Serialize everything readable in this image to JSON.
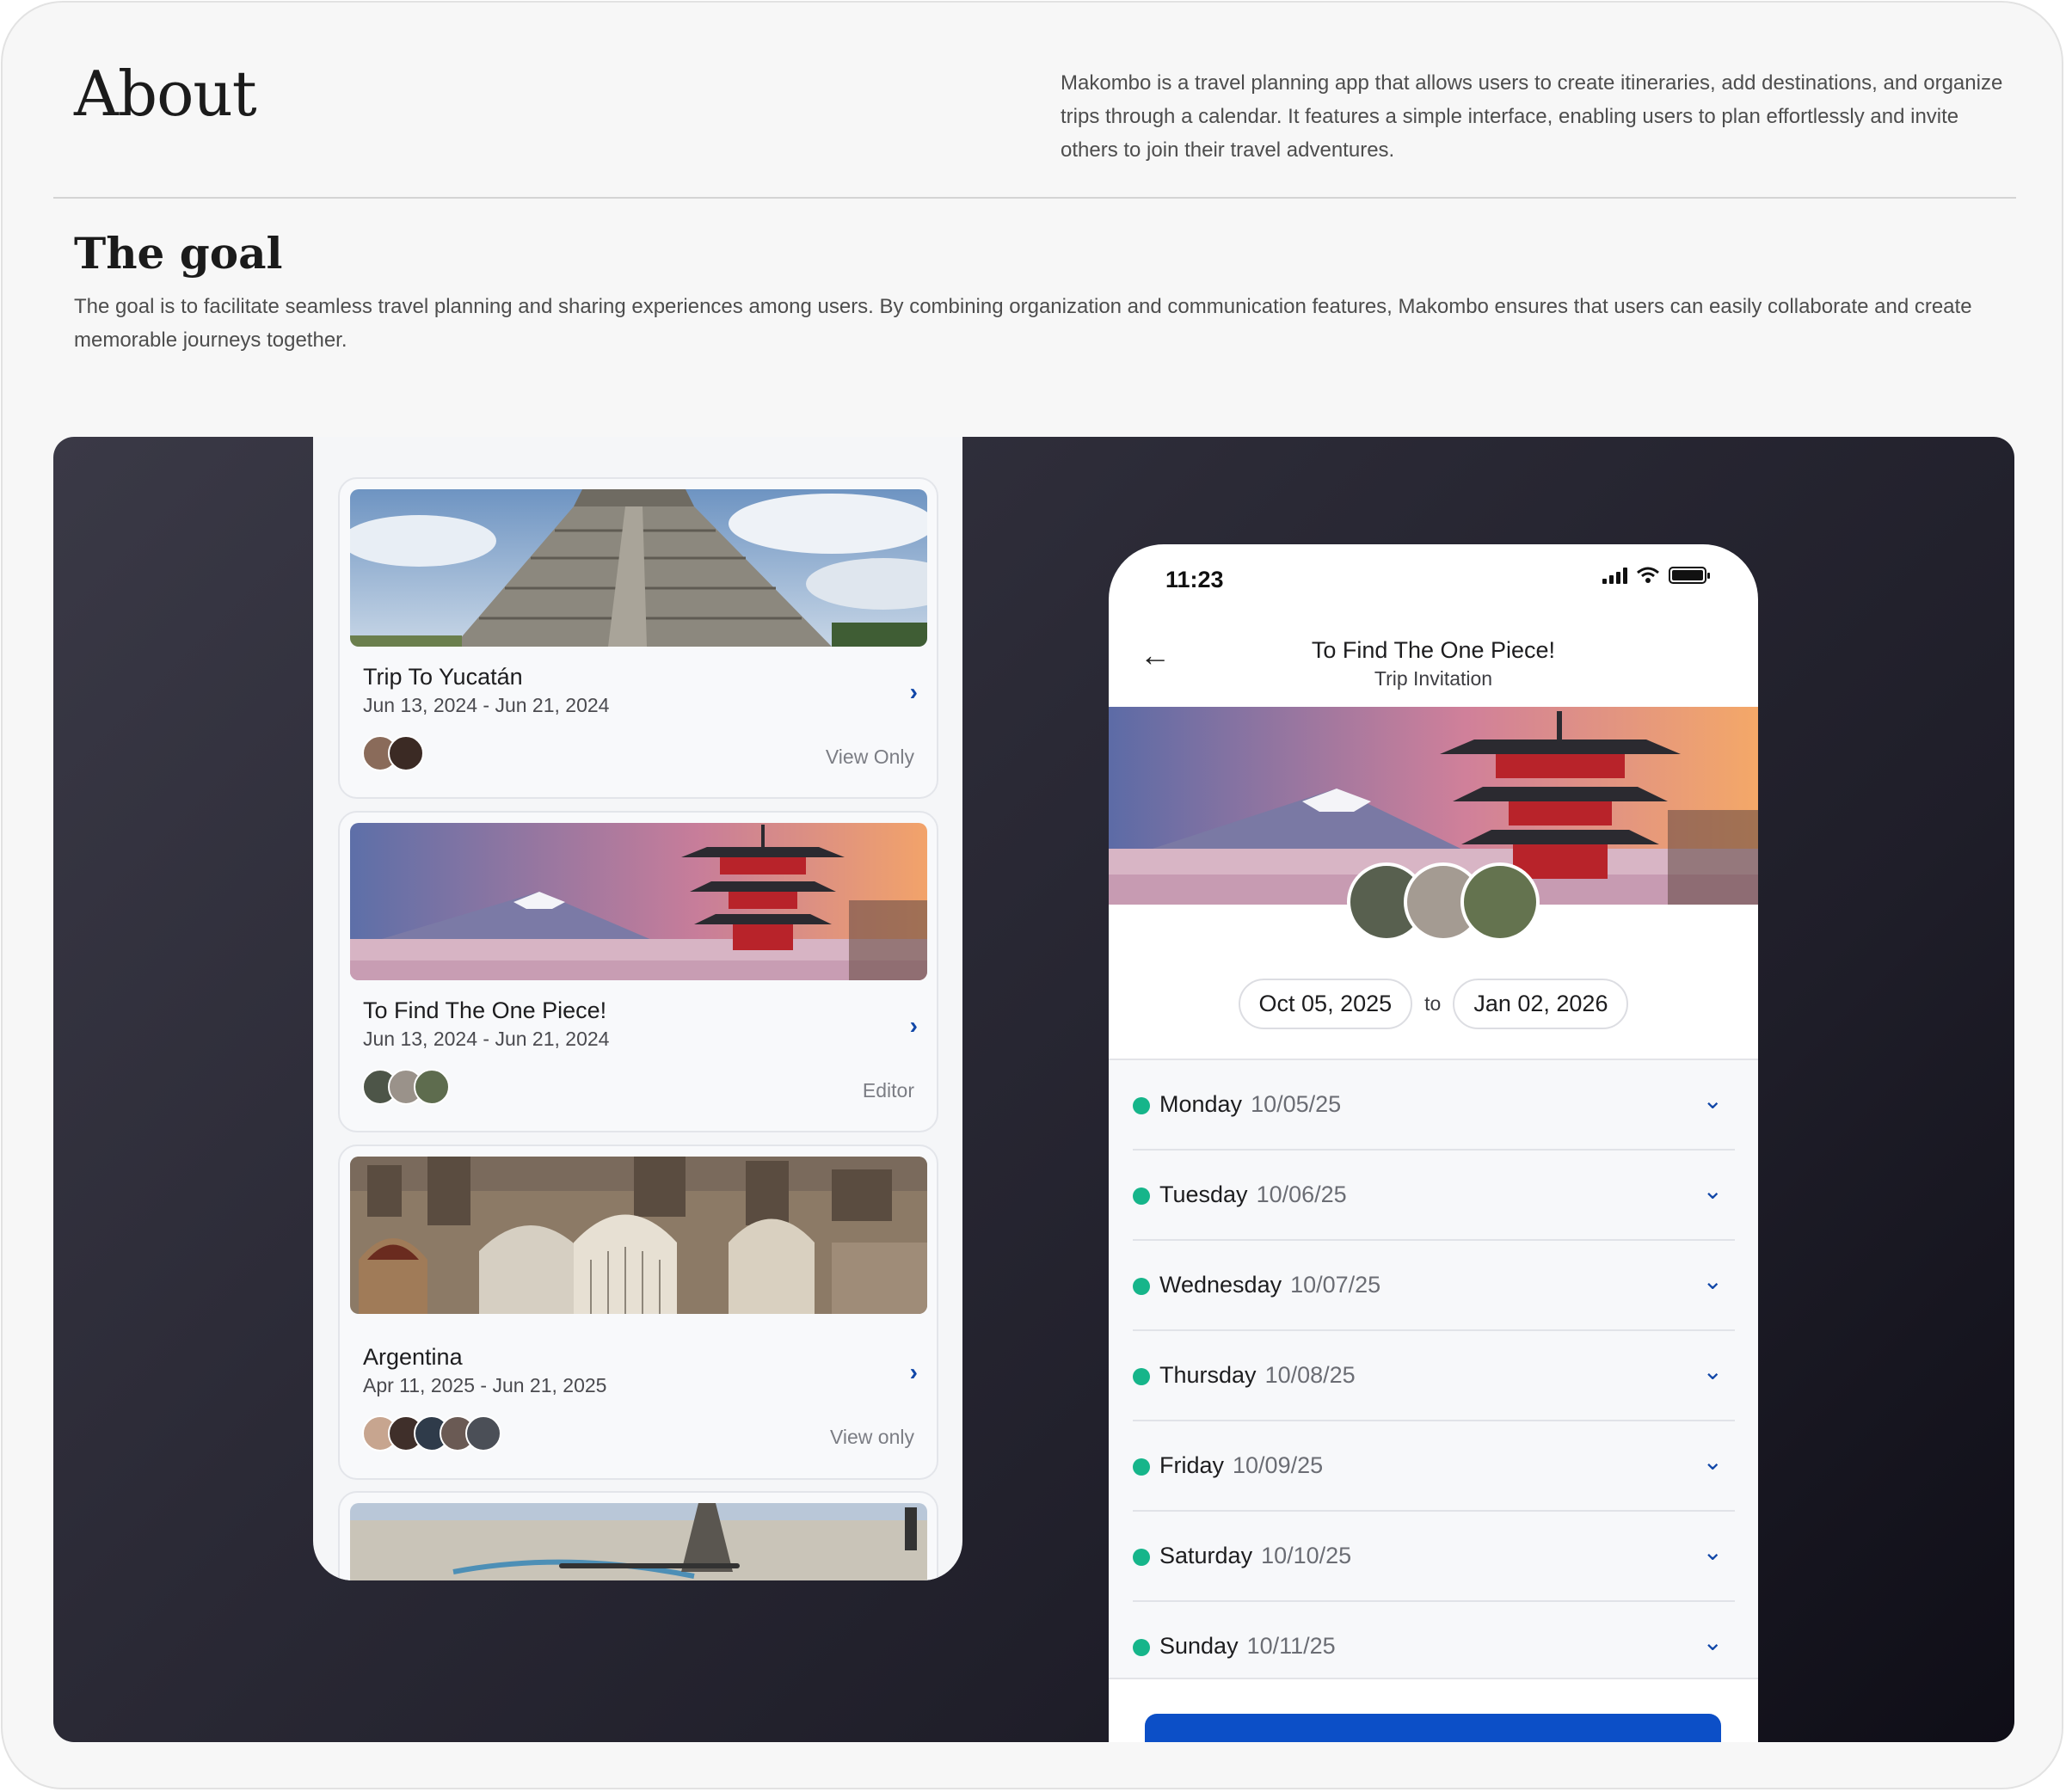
{
  "about": {
    "title": "About",
    "text": "Makombo is a travel planning app that allows users to create itineraries, add destinations, and organize trips through a calendar. It features a simple interface, enabling users to plan effortlessly and invite others to join their travel adventures."
  },
  "goal": {
    "title": "The goal",
    "text": "The goal is to facilitate seamless travel planning and sharing experiences among users. By combining organization and communication features, Makombo ensures that users can easily collaborate and create memorable journeys together."
  },
  "trips": [
    {
      "name": "Trip To Yucatán",
      "dates": "Jun 13, 2024 - Jun 21, 2024",
      "role": "View Only"
    },
    {
      "name": "To Find The One Piece!",
      "dates": "Jun 13, 2024 - Jun 21, 2024",
      "role": "Editor"
    },
    {
      "name": "Argentina",
      "dates": "Apr 11, 2025 - Jun 21, 2025",
      "role": "View only"
    }
  ],
  "invite": {
    "time": "11:23",
    "title": "To Find The One Piece!",
    "subtitle": "Trip Invitation",
    "start_date": "Oct 05, 2025",
    "to_label": "to",
    "end_date": "Jan 02, 2026",
    "days": [
      {
        "name": "Monday",
        "date": "10/05/25"
      },
      {
        "name": "Tuesday",
        "date": "10/06/25"
      },
      {
        "name": "Wednesday",
        "date": "10/07/25"
      },
      {
        "name": "Thursday",
        "date": "10/08/25"
      },
      {
        "name": "Friday",
        "date": "10/09/25"
      },
      {
        "name": "Saturday",
        "date": "10/10/25"
      },
      {
        "name": "Sunday",
        "date": "10/11/25"
      }
    ]
  },
  "colors": {
    "accent": "#0c4fc7",
    "chevron": "#1147a8",
    "status_dot": "#16b58a"
  }
}
